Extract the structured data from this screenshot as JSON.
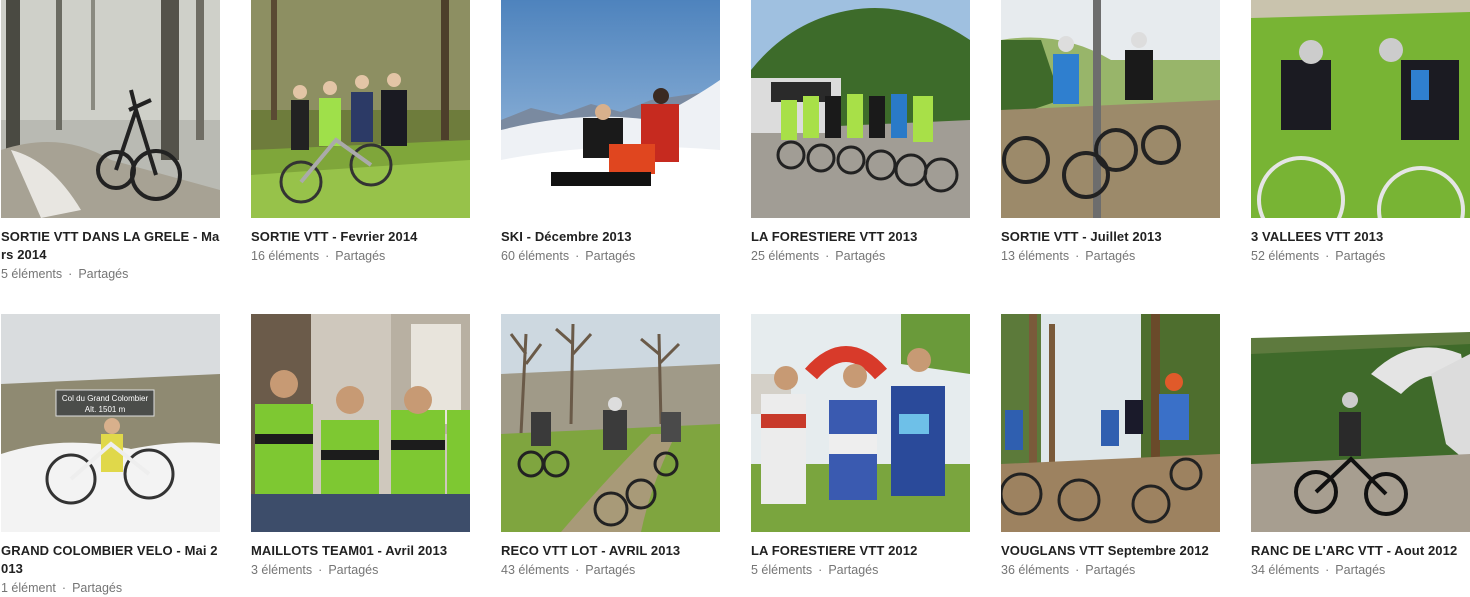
{
  "albums": [
    {
      "title": "SORTIE VTT DANS LA GRELE - Mars 2014",
      "count": "5 éléments",
      "sep": "·",
      "shared": "Partagés",
      "scene": "forest-hail",
      "bike": "yes",
      "people": 0
    },
    {
      "title": "SORTIE VTT - Fevrier 2014",
      "count": "16 éléments",
      "sep": "·",
      "shared": "Partagés",
      "scene": "forest-green",
      "bike": "yes",
      "people": 4
    },
    {
      "title": "SKI - Décembre 2013",
      "count": "60 éléments",
      "sep": "·",
      "shared": "Partagés",
      "scene": "snow",
      "bike": "no",
      "people": 3
    },
    {
      "title": "LA FORESTIERE VTT 2013",
      "count": "25 éléments",
      "sep": "·",
      "shared": "Partagés",
      "scene": "road-trees",
      "bike": "yes",
      "people": 8
    },
    {
      "title": "SORTIE VTT - Juillet 2013",
      "count": "13 éléments",
      "sep": "·",
      "shared": "Partagés",
      "scene": "hill-summer",
      "bike": "yes",
      "people": 2
    },
    {
      "title": "3 VALLEES VTT 2013",
      "count": "52 éléments",
      "sep": "·",
      "shared": "Partagés",
      "scene": "grass",
      "bike": "yes",
      "people": 2
    },
    {
      "title": "GRAND COLOMBIER VELO - Mai 2013",
      "count": "1 élément",
      "sep": "·",
      "shared": "Partagés",
      "scene": "fog-snow",
      "bike": "yes",
      "people": 1,
      "sign_line1": "Col du Grand Colombier",
      "sign_line2": "Alt. 1501 m"
    },
    {
      "title": "MAILLOTS TEAM01 - Avril 2013",
      "count": "3 éléments",
      "sep": "·",
      "shared": "Partagés",
      "scene": "indoor",
      "bike": "no",
      "people": 4
    },
    {
      "title": "RECO VTT LOT - AVRIL 2013",
      "count": "43 éléments",
      "sep": "·",
      "shared": "Partagés",
      "scene": "trail-spring",
      "bike": "yes",
      "people": 5
    },
    {
      "title": "LA FORESTIERE VTT 2012",
      "count": "5 éléments",
      "sep": "·",
      "shared": "Partagés",
      "scene": "event",
      "bike": "no",
      "people": 3
    },
    {
      "title": "VOUGLANS VTT Septembre 2012",
      "count": "36 éléments",
      "sep": "·",
      "shared": "Partagés",
      "scene": "forest-path",
      "bike": "yes",
      "people": 4
    },
    {
      "title": "RANC DE L'ARC VTT - Aout 2012",
      "count": "34 éléments",
      "sep": "·",
      "shared": "Partagés",
      "scene": "rock-arch",
      "bike": "yes",
      "people": 1
    }
  ],
  "colors": {
    "title": "#212121",
    "meta": "#757575",
    "jersey_green": "#7ec832",
    "jersey_black": "#1c1c1c"
  }
}
